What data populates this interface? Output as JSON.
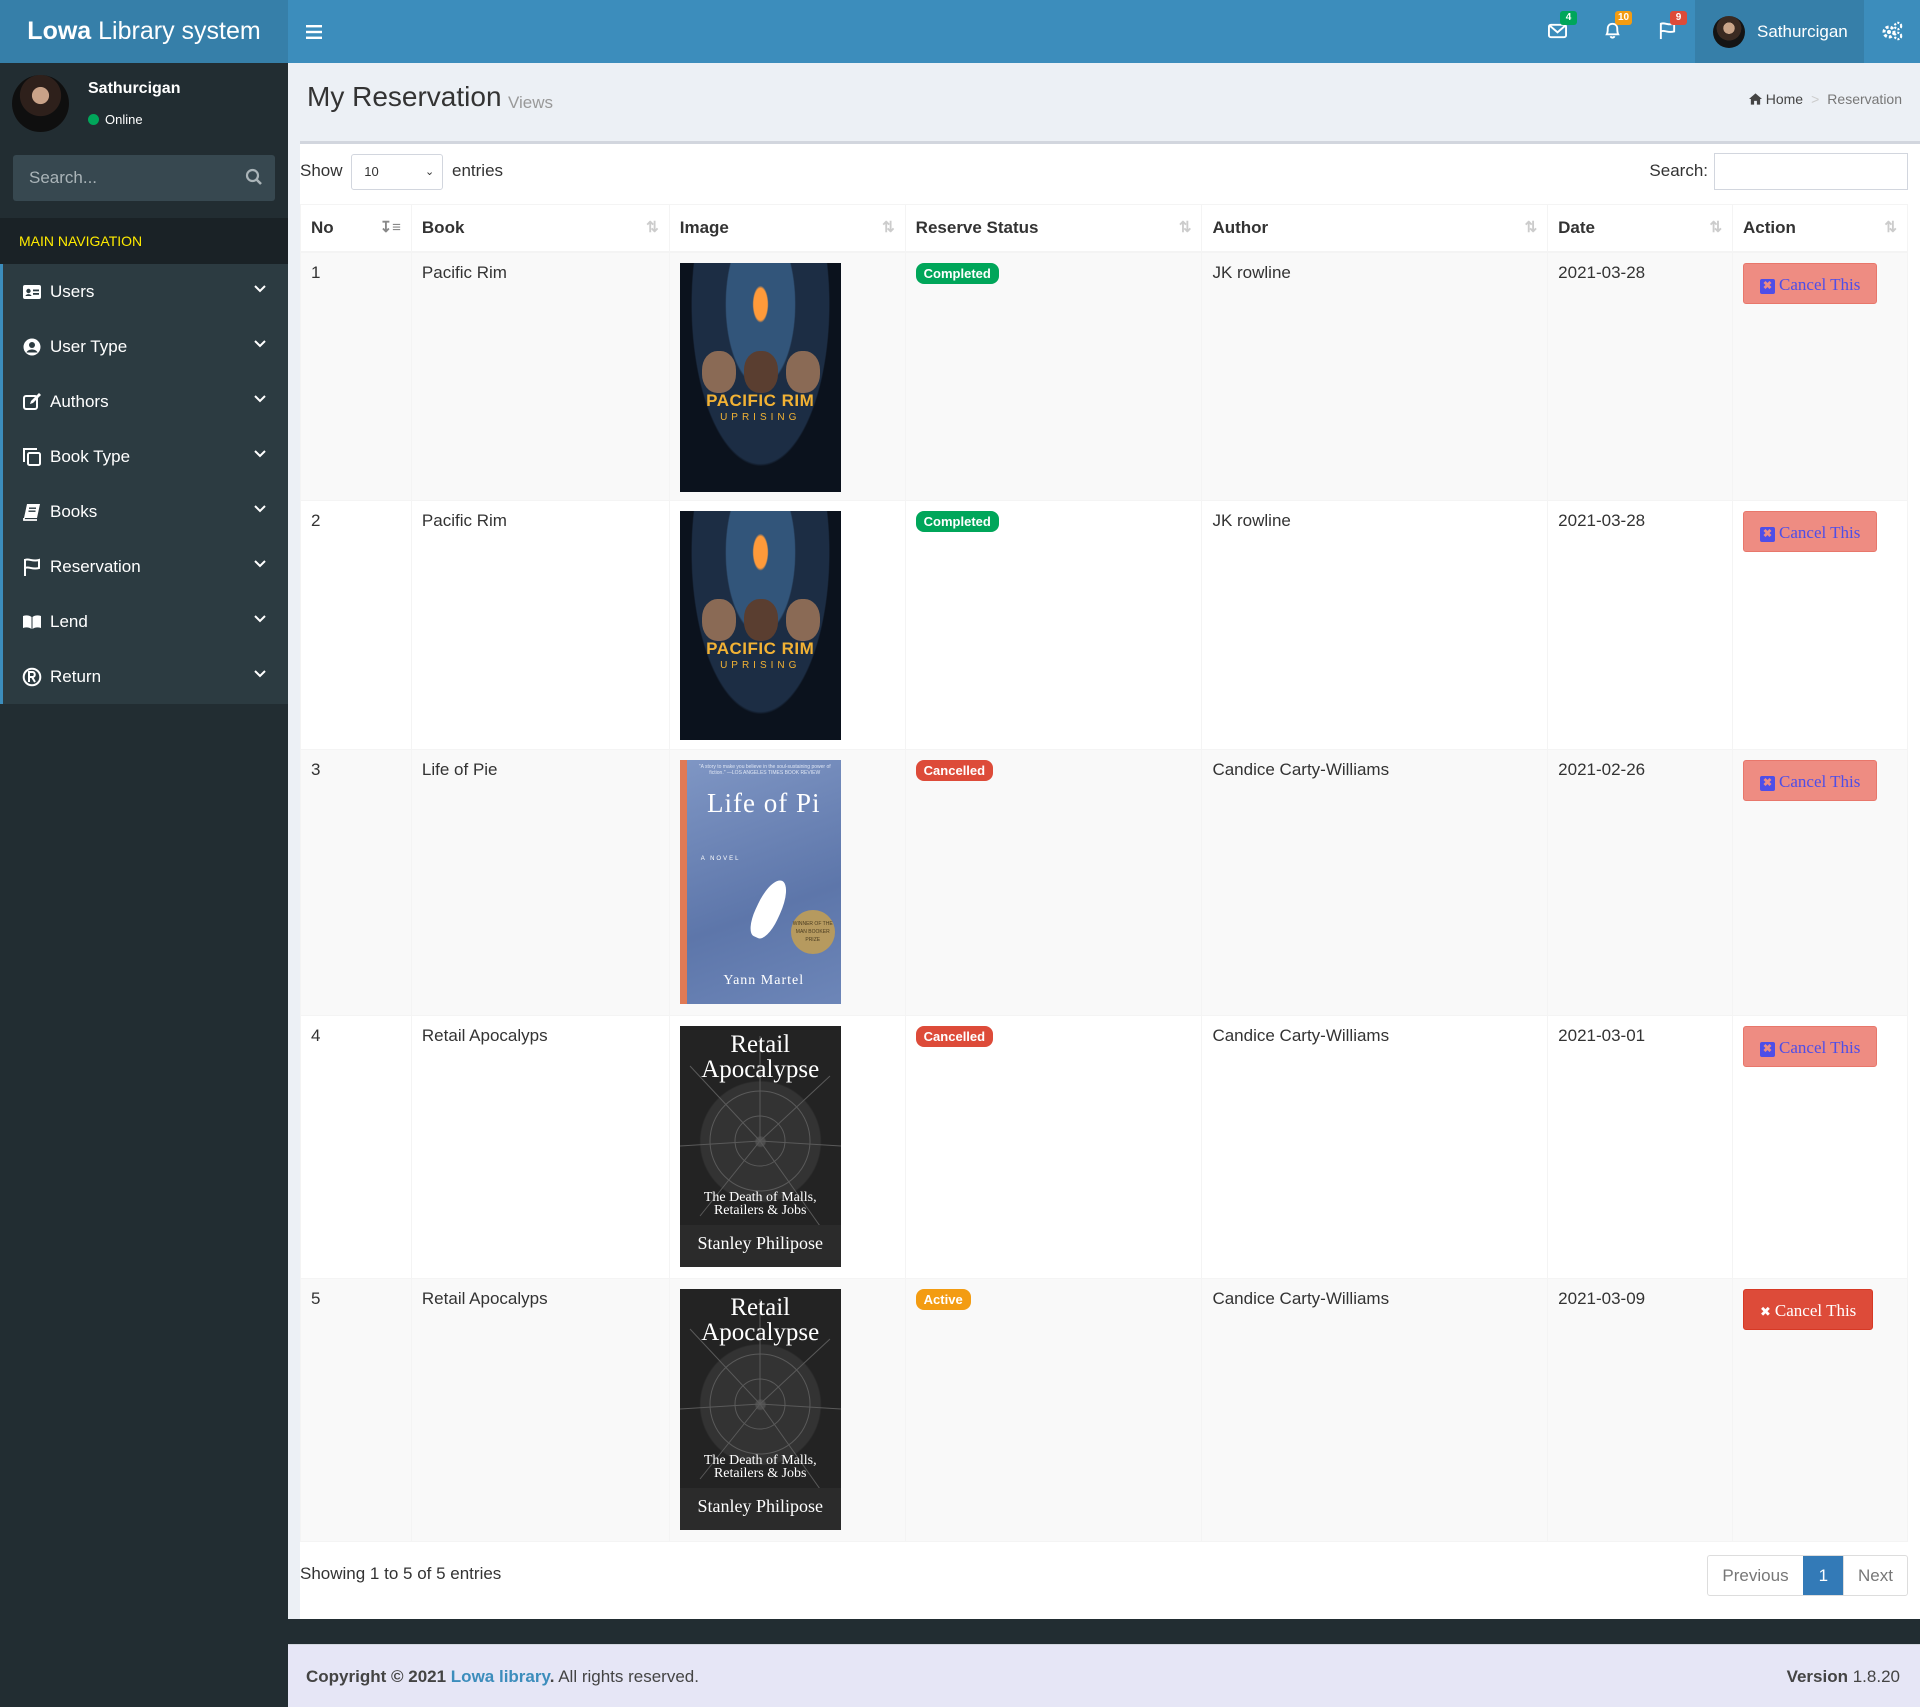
{
  "app": {
    "logo_bold": "Lowa",
    "logo_rest": " Library system"
  },
  "header": {
    "messages_badge": "4",
    "notifications_badge": "10",
    "tasks_badge": "9",
    "user_name": "Sathurcigan",
    "badge_colors": {
      "messages": "#00a65a",
      "notifications": "#f39c12",
      "tasks": "#dd4b39"
    }
  },
  "sidebar": {
    "user_name": "Sathurcigan",
    "status": "Online",
    "search_placeholder": "Search...",
    "nav_header": "MAIN NAVIGATION",
    "items": [
      {
        "label": "Users",
        "icon": "id-card-icon"
      },
      {
        "label": "User Type",
        "icon": "user-circle-icon"
      },
      {
        "label": "Authors",
        "icon": "edit-icon"
      },
      {
        "label": "Book Type",
        "icon": "copy-icon"
      },
      {
        "label": "Books",
        "icon": "book-icon"
      },
      {
        "label": "Reservation",
        "icon": "flag-icon"
      },
      {
        "label": "Lend",
        "icon": "open-book-icon"
      },
      {
        "label": "Return",
        "icon": "registered-icon"
      }
    ]
  },
  "page": {
    "title": "My Reservation",
    "subtitle": "Views",
    "breadcrumb_home": "Home",
    "breadcrumb_current": "Reservation"
  },
  "table": {
    "show_label": "Show",
    "entries_label": "entries",
    "page_length": "10",
    "search_label": "Search:",
    "columns": [
      "No",
      "Book",
      "Image",
      "Reserve Status",
      "Author",
      "Date",
      "Action"
    ],
    "rows": [
      {
        "no": "1",
        "book": "Pacific Rim",
        "cover": "pacific-rim-cover",
        "status": "Completed",
        "author": "JK rowline",
        "date": "2021-03-28",
        "action": "Cancel This"
      },
      {
        "no": "2",
        "book": "Pacific Rim",
        "cover": "pacific-rim-cover",
        "status": "Completed",
        "author": "JK rowline",
        "date": "2021-03-28",
        "action": "Cancel This"
      },
      {
        "no": "3",
        "book": "Life of Pie",
        "cover": "life-of-pi-cover",
        "status": "Cancelled",
        "author": "Candice Carty-Williams",
        "date": "2021-02-26",
        "action": "Cancel This"
      },
      {
        "no": "4",
        "book": "Retail Apocalyps",
        "cover": "retail-apocalypse-cover",
        "status": "Cancelled",
        "author": "Candice Carty-Williams",
        "date": "2021-03-01",
        "action": "Cancel This"
      },
      {
        "no": "5",
        "book": "Retail Apocalyps",
        "cover": "retail-apocalypse-cover",
        "status": "Active",
        "author": "Candice Carty-Williams",
        "date": "2021-03-09",
        "action": "Cancel This"
      }
    ],
    "covers": {
      "pacific_rim": {
        "title": "PACIFIC RIM",
        "subtitle": "UPRISING"
      },
      "life_of_pi": {
        "quote": "\"A story to make you believe in the soul-sustaining power of fiction.\" —LOS ANGELES TIMES BOOK REVIEW",
        "title": "Life of Pi",
        "tag": "A NOVEL",
        "seal": "WINNER OF THE MAN BOOKER PRIZE",
        "author": "Yann Martel"
      },
      "retail_apocalypse": {
        "title_line1": "Retail",
        "title_line2": "Apocalypse",
        "subtitle_line1": "The Death of Malls,",
        "subtitle_line2": "Retailers & Jobs",
        "author": "Stanley Philipose"
      }
    },
    "info": "Showing 1 to 5 of 5 entries",
    "pager": {
      "previous": "Previous",
      "current": "1",
      "next": "Next"
    }
  },
  "footer": {
    "copyright_prefix": "Copyright © 2021 ",
    "brand": "Lowa library",
    "copyright_suffix": ". All rights reserved.",
    "version_label": "Version",
    "version_value": " 1.8.20"
  }
}
